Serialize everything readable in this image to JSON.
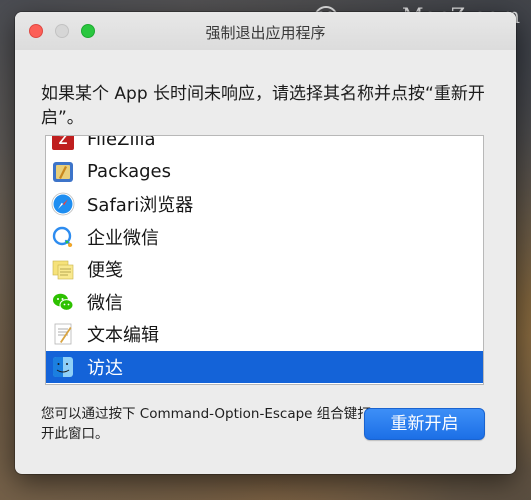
{
  "watermark": {
    "reg": "M",
    "text": "www.MacZ.com"
  },
  "window": {
    "title": "强制退出应用程序",
    "instructions": "如果某个 App 长时间未响应，请选择其名称并点按“重新开启”。",
    "apps": [
      {
        "name": "FileZilla",
        "icon": "filezilla-icon"
      },
      {
        "name": "Packages",
        "icon": "packages-icon"
      },
      {
        "name": "Safari浏览器",
        "icon": "safari-icon"
      },
      {
        "name": "企业微信",
        "icon": "wecom-icon"
      },
      {
        "name": "便笺",
        "icon": "stickies-icon"
      },
      {
        "name": "微信",
        "icon": "wechat-icon"
      },
      {
        "name": "文本编辑",
        "icon": "textedit-icon"
      },
      {
        "name": "访达",
        "icon": "finder-icon",
        "selected": true
      }
    ],
    "footer_text": "您可以通过按下 Command-Option-Escape 组合键打开此窗口。",
    "relaunch_label": "重新开启"
  },
  "colors": {
    "selection": "#1463d8",
    "button": "#1c6fe6",
    "close": "#fc5f57",
    "maximize": "#2ac73f"
  }
}
